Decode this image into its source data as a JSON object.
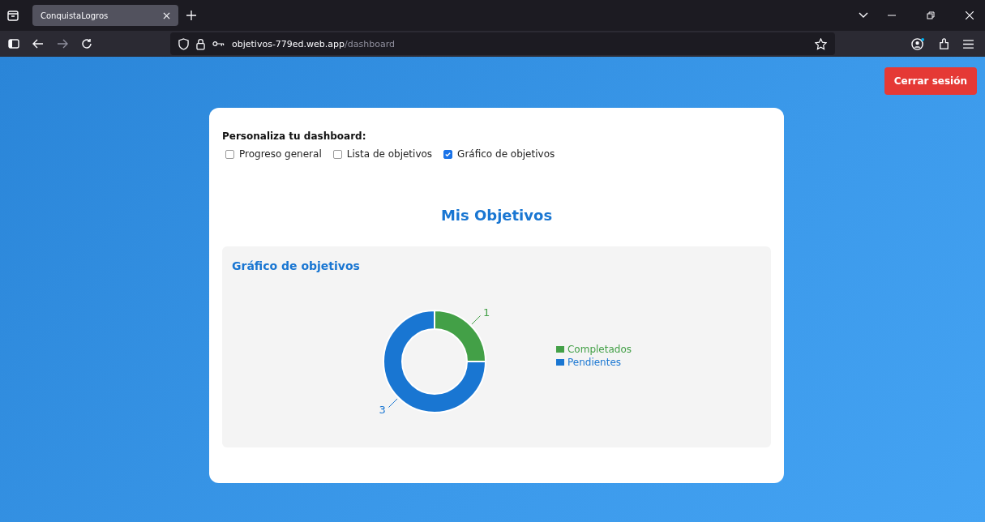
{
  "browser": {
    "tab": {
      "title": "ConquistaLogros",
      "selected": true
    },
    "url": {
      "host": "objetivos-779ed.web.app",
      "path": "/dashboard"
    }
  },
  "logout_button": "Cerrar sesión",
  "customize": {
    "label": "Personaliza tu dashboard:",
    "options": [
      {
        "label": "Progreso general",
        "checked": false
      },
      {
        "label": "Lista de objetivos",
        "checked": false
      },
      {
        "label": "Gráfico de objetivos",
        "checked": true
      }
    ]
  },
  "heading": "Mis Objetivos",
  "chart_panel": {
    "title": "Gráfico de objetivos",
    "chart_data": {
      "type": "donut",
      "data_labels": true,
      "categories": [
        "Completados",
        "Pendientes"
      ],
      "values": [
        1,
        3
      ],
      "colors": [
        "#43a047",
        "#1976d2"
      ],
      "legend": "right"
    }
  }
}
